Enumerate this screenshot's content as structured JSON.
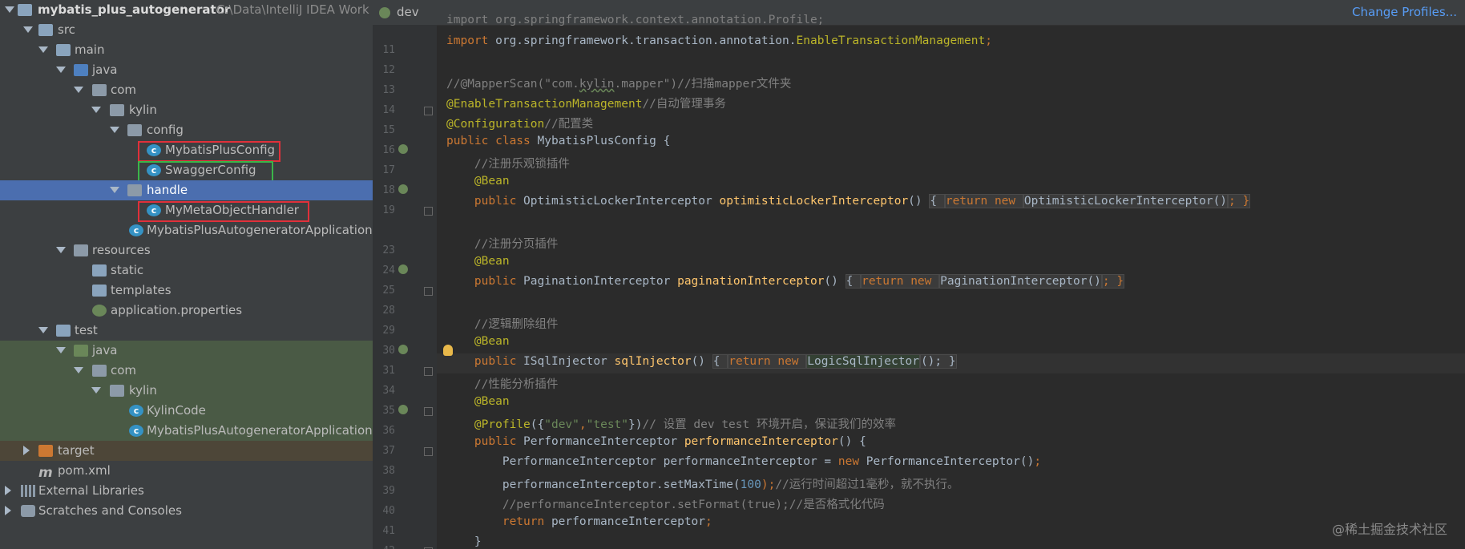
{
  "project": {
    "root_name": "mybatis_plus_autogenerator",
    "root_path": "C:\\Data\\IntelliJ IDEA Work S",
    "tree": [
      {
        "label": "src",
        "icon": "folder-icon"
      },
      {
        "label": "main",
        "icon": "folder-icon"
      },
      {
        "label": "java",
        "icon": "source-folder-icon"
      },
      {
        "label": "com",
        "icon": "package-icon"
      },
      {
        "label": "kylin",
        "icon": "package-icon"
      },
      {
        "label": "config",
        "icon": "package-icon"
      },
      {
        "label": "MybatisPlusConfig",
        "icon": "class-icon"
      },
      {
        "label": "SwaggerConfig",
        "icon": "class-icon"
      },
      {
        "label": "handle",
        "icon": "package-icon"
      },
      {
        "label": "MyMetaObjectHandler",
        "icon": "class-icon"
      },
      {
        "label": "MybatisPlusAutogeneratorApplication",
        "icon": "spring-boot-class-icon"
      },
      {
        "label": "resources",
        "icon": "resources-folder-icon"
      },
      {
        "label": "static",
        "icon": "folder-icon"
      },
      {
        "label": "templates",
        "icon": "folder-icon"
      },
      {
        "label": "application.properties",
        "icon": "spring-properties-icon"
      },
      {
        "label": "test",
        "icon": "folder-icon"
      },
      {
        "label": "java",
        "icon": "test-source-folder-icon"
      },
      {
        "label": "com",
        "icon": "package-icon"
      },
      {
        "label": "kylin",
        "icon": "package-icon"
      },
      {
        "label": "KylinCode",
        "icon": "class-icon"
      },
      {
        "label": "MybatisPlusAutogeneratorApplication",
        "icon": "class-icon"
      },
      {
        "label": "target",
        "icon": "excluded-folder-icon"
      },
      {
        "label": "pom.xml",
        "icon": "maven-icon"
      },
      {
        "label": "External Libraries",
        "icon": "library-icon"
      },
      {
        "label": "Scratches and Consoles",
        "icon": "scratch-icon"
      }
    ]
  },
  "editor": {
    "tab_label": "dev",
    "change_profiles": "Change Profiles...",
    "line_numbers": [
      "",
      "11",
      "12",
      "13",
      "14",
      "15",
      "16",
      "17",
      "18",
      "19",
      "23",
      "24",
      "25",
      "28",
      "29",
      "30",
      "31",
      "34",
      "35",
      "36",
      "37",
      "38",
      "39",
      "40",
      "41",
      "42"
    ],
    "lines": {
      "l10": "import org.springframework.context.annotation.Profile;",
      "l11_a": "import ",
      "l11_b": "org.springframework.transaction.annotation.",
      "l11_c": "EnableTransactionManagement",
      "l11_d": ";",
      "l13_a": "//@MapperScan(\"com.",
      "l13_b": "kylin",
      "l13_c": ".mapper\")//扫描mapper文件夹",
      "l14_a": "@EnableTransactionManagement",
      "l14_b": "//自动管理事务",
      "l15_a": "@Configuration",
      "l15_b": "//配置类",
      "l16_a": "public class ",
      "l16_b": "MybatisPlusConfig {",
      "l17": "    //注册乐观锁插件",
      "l18": "    @Bean",
      "l19_a": "    public ",
      "l19_b": "OptimisticLockerInterceptor ",
      "l19_c": "optimisticLockerInterceptor",
      "l19_d": "() ",
      "l19_e": "{ ",
      "l19_f": "return new ",
      "l19_g": "OptimisticLockerInterceptor()",
      "l19_h": "; }",
      "l23": "    //注册分页插件",
      "l24": "    @Bean",
      "l25_a": "    public ",
      "l25_b": "PaginationInterceptor ",
      "l25_c": "paginationInterceptor",
      "l25_d": "() ",
      "l25_e": "{ ",
      "l25_f": "return new ",
      "l25_g": "PaginationInterceptor()",
      "l25_h": "; }",
      "l29": "    //逻辑删除组件",
      "l30": "    @Bean",
      "l31_a": "    public ",
      "l31_b": "ISqlInjector ",
      "l31_c": "sqlInjector",
      "l31_d": "() ",
      "l31_e": "{ ",
      "l31_f": "return new ",
      "l31_g": "LogicSqlInjector",
      "l31_h": "(); }",
      "l34": "    //性能分析插件",
      "l35": "    @Bean",
      "l36_a": "    @Profile",
      "l36_b": "({",
      "l36_c": "\"dev\"",
      "l36_d": ",",
      "l36_e": "\"test\"",
      "l36_f": "})",
      "l36_g": "// 设置 dev test 环境开启，保证我们的效率",
      "l37_a": "    public ",
      "l37_b": "PerformanceInterceptor ",
      "l37_c": "performanceInterceptor",
      "l37_d": "() {",
      "l38_a": "        PerformanceInterceptor performanceInterceptor = ",
      "l38_b": "new ",
      "l38_c": "PerformanceInterceptor()",
      "l38_d": ";",
      "l39_a": "        performanceInterceptor.setMaxTime(",
      "l39_b": "100",
      "l39_c": ");",
      "l39_d": "//运行时间超过1毫秒，就不执行。",
      "l40": "        //performanceInterceptor.setFormat(true);//是否格式化代码",
      "l41_a": "        ",
      "l41_b": "return ",
      "l41_c": "performanceInterceptor",
      "l41_d": ";",
      "l42": "    }"
    }
  },
  "watermark": "@稀土掘金技术社区"
}
